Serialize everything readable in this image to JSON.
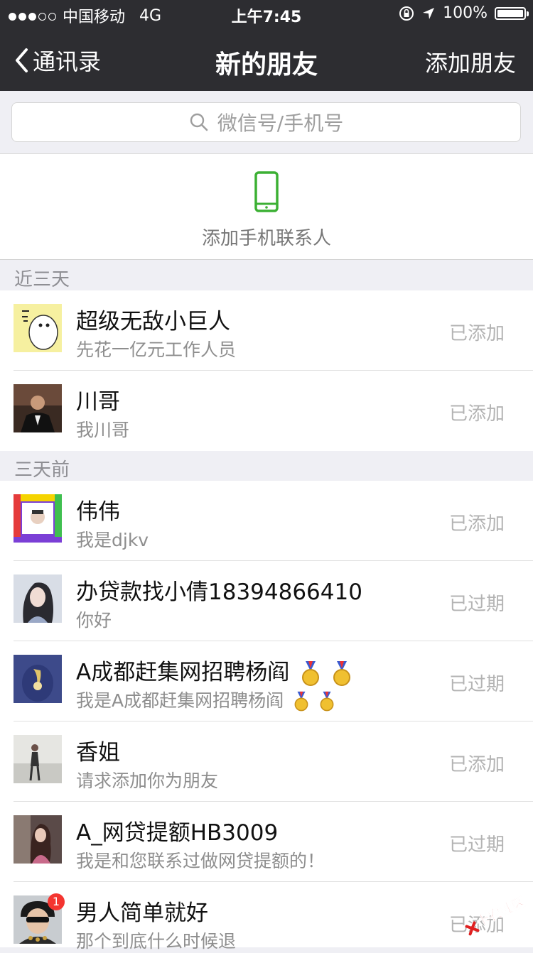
{
  "status_bar": {
    "carrier": "中国移动",
    "network": "4G",
    "time": "上午7:45",
    "battery": "100%"
  },
  "nav": {
    "back_label": "通讯录",
    "title": "新的朋友",
    "right_action": "添加朋友"
  },
  "search": {
    "placeholder": "微信号/手机号"
  },
  "add_phone_contacts": {
    "label": "添加手机联系人"
  },
  "sections": [
    {
      "title": "近三天",
      "items": [
        {
          "name": "超级无敌小巨人",
          "message": "先花一亿元工作人员",
          "status": "已添加"
        },
        {
          "name": "川哥",
          "message": "我川哥",
          "status": "已添加"
        }
      ]
    },
    {
      "title": "三天前",
      "items": [
        {
          "name": "伟伟",
          "message": "我是djkv",
          "status": "已添加"
        },
        {
          "name": "办贷款找小倩18394866410",
          "message": "你好",
          "status": "已过期"
        },
        {
          "name": "A成都赶集网招聘杨阎",
          "message": "我是A成都赶集网招聘杨阎",
          "status": "已过期"
        },
        {
          "name": "香姐",
          "message": "请求添加你为朋友",
          "status": "已添加"
        },
        {
          "name": "A_网贷提额HB3009",
          "message": "我是和您联系过做网贷提额的！",
          "status": "已过期"
        },
        {
          "name": "男人简单就好",
          "message": "那个到底什么时候退",
          "status": "已添加",
          "badge": "1"
        }
      ]
    }
  ],
  "watermark": {
    "text": "卡农社区"
  },
  "colors": {
    "nav_bg": "#2d2d31",
    "accent_green": "#3cb034",
    "status_gray": "#b3b3b3"
  }
}
